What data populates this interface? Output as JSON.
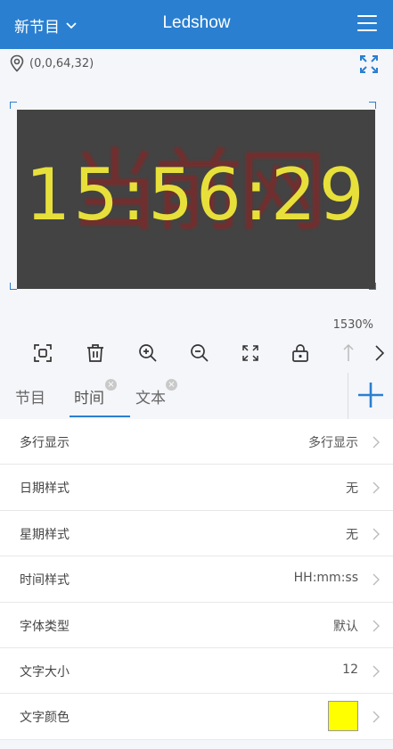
{
  "header": {
    "program_selector": "新节目",
    "title": "Ledshow"
  },
  "canvas": {
    "coords": "(0,0,64,32)",
    "led_background_text": "当前网",
    "led_time": "15:56:29",
    "zoom": "1530%"
  },
  "toolbar": {
    "icons": [
      "fit-icon",
      "trash-icon",
      "zoom-in-icon",
      "zoom-out-icon",
      "expand-icon",
      "lock-icon",
      "arrow-up-icon",
      "chevron-right-icon"
    ]
  },
  "tabs": [
    {
      "label": "节目"
    },
    {
      "label": "时间"
    },
    {
      "label": "文本"
    }
  ],
  "settings": [
    {
      "label": "多行显示",
      "value": "多行显示"
    },
    {
      "label": "日期样式",
      "value": "无"
    },
    {
      "label": "星期样式",
      "value": "无"
    },
    {
      "label": "时间样式",
      "value": "HH:mm:ss"
    },
    {
      "label": "字体类型",
      "value": "默认"
    },
    {
      "label": "文字大小",
      "value": "12"
    },
    {
      "label": "文字颜色",
      "value": ""
    }
  ],
  "colors": {
    "accent": "#2a7fd0",
    "text_color_swatch": "#ffff00",
    "led_text": "#e8e03a",
    "led_bg": "#434343"
  }
}
